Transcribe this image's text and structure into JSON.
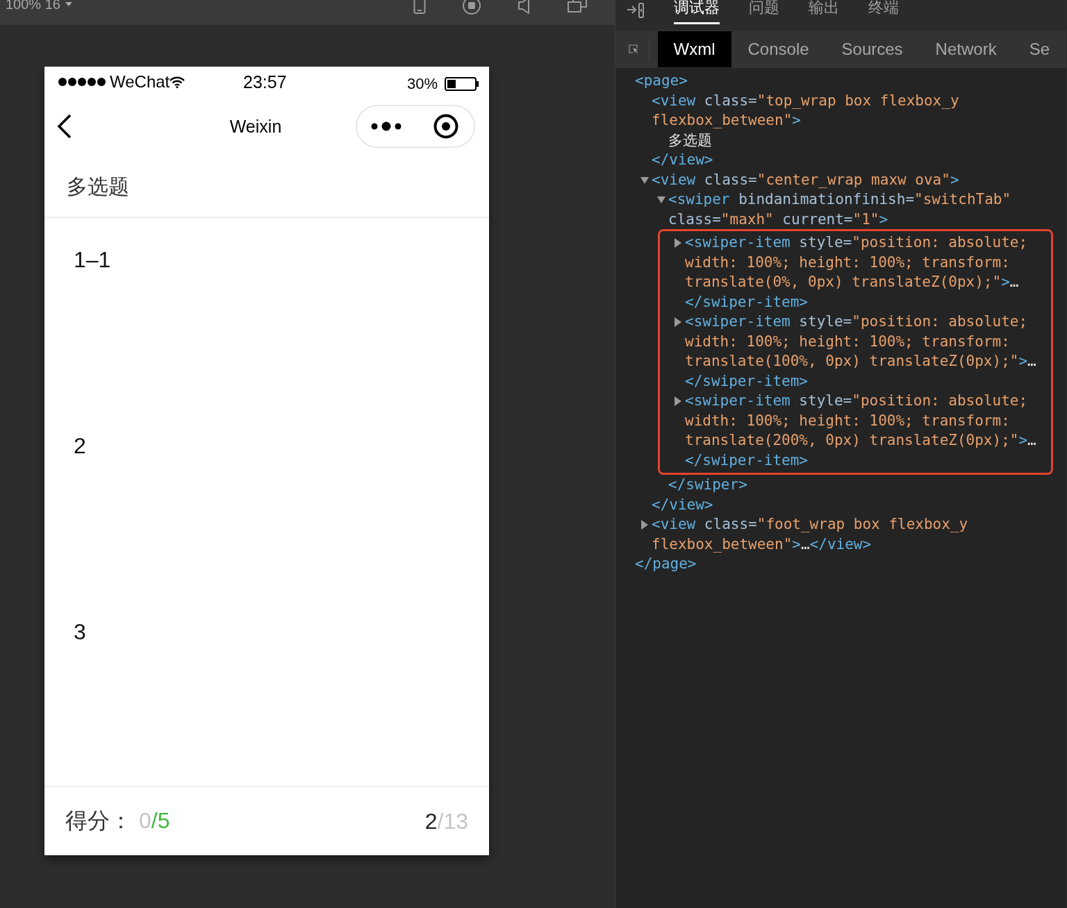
{
  "simulator": {
    "toolbar": {
      "zoom": "100% 16"
    },
    "status_bar": {
      "carrier": "WeChat",
      "time": "23:57",
      "battery": "30%"
    },
    "nav": {
      "title": "Weixin"
    },
    "header": {
      "title": "多选题"
    },
    "items": [
      {
        "label": "1–1"
      },
      {
        "label": "2"
      },
      {
        "label": "3"
      }
    ],
    "footer": {
      "score_label": "得分：",
      "score_earned": "0",
      "score_total": "/5",
      "progress_current": "2",
      "progress_rest": "/13"
    }
  },
  "devtools": {
    "top_tabs": [
      {
        "label": "调试器",
        "selected": true
      },
      {
        "label": "问题",
        "selected": false
      },
      {
        "label": "输出",
        "selected": false
      },
      {
        "label": "终端",
        "selected": false
      }
    ],
    "panel_tabs": [
      {
        "label": "Wxml",
        "selected": true
      },
      {
        "label": "Console",
        "selected": false
      },
      {
        "label": "Sources",
        "selected": false
      },
      {
        "label": "Network",
        "selected": false
      },
      {
        "label": "Se",
        "selected": false
      }
    ],
    "wxml_tree": [
      {
        "kind": "element",
        "open": [
          {
            "kind": "tag",
            "text": "<page>"
          }
        ],
        "close": [
          {
            "kind": "tag",
            "text": "</page>"
          }
        ],
        "children": [
          {
            "kind": "element",
            "open": [
              {
                "kind": "tag",
                "text": "<view"
              },
              {
                "kind": "attr",
                "text": " class="
              },
              {
                "kind": "value",
                "text": "\"top_wrap box flexbox_y flexbox_between\""
              },
              {
                "kind": "tag",
                "text": ">"
              }
            ],
            "close": [
              {
                "kind": "tag",
                "text": "</view>"
              }
            ],
            "children": [
              {
                "kind": "text",
                "open": [
                  {
                    "kind": "text",
                    "text": "多选题"
                  }
                ]
              }
            ]
          },
          {
            "kind": "toggle",
            "expanded": true,
            "open": [
              {
                "kind": "tag",
                "text": "<view"
              },
              {
                "kind": "attr",
                "text": " class="
              },
              {
                "kind": "value",
                "text": "\"center_wrap maxw ova\""
              },
              {
                "kind": "tag",
                "text": ">"
              }
            ],
            "close": [
              {
                "kind": "tag",
                "text": "</view>"
              }
            ],
            "children": [
              {
                "kind": "toggle",
                "expanded": true,
                "open": [
                  {
                    "kind": "tag",
                    "text": "<swiper"
                  },
                  {
                    "kind": "attr",
                    "text": " bindanimationfinish="
                  },
                  {
                    "kind": "value",
                    "text": "\"switchTab\""
                  },
                  {
                    "kind": "attr",
                    "text": " class="
                  },
                  {
                    "kind": "value",
                    "text": "\"maxh\""
                  },
                  {
                    "kind": "attr",
                    "text": " current="
                  },
                  {
                    "kind": "value",
                    "text": "\"1\""
                  },
                  {
                    "kind": "tag",
                    "text": ">"
                  }
                ],
                "close": [
                  {
                    "kind": "tag",
                    "text": "</swiper>"
                  }
                ],
                "children": [
                  {
                    "kind": "toggle",
                    "expanded": false,
                    "highlighted": true,
                    "open": [
                      {
                        "kind": "tag",
                        "text": "<swiper-item"
                      },
                      {
                        "kind": "attr",
                        "text": " style="
                      },
                      {
                        "kind": "value",
                        "text": "\"position: absolute; width: 100%; height: 100%; transform: translate(0%, 0px) translateZ(0px);\""
                      },
                      {
                        "kind": "tag",
                        "text": ">"
                      },
                      {
                        "kind": "text",
                        "text": "…"
                      }
                    ],
                    "close": [
                      {
                        "kind": "tag",
                        "text": "</swiper-item>"
                      }
                    ]
                  },
                  {
                    "kind": "toggle",
                    "expanded": false,
                    "highlighted": true,
                    "open": [
                      {
                        "kind": "tag",
                        "text": "<swiper-item"
                      },
                      {
                        "kind": "attr",
                        "text": " style="
                      },
                      {
                        "kind": "value",
                        "text": "\"position: absolute; width: 100%; height: 100%; transform: translate(100%, 0px) translateZ(0px);\""
                      },
                      {
                        "kind": "tag",
                        "text": ">"
                      },
                      {
                        "kind": "text",
                        "text": "…"
                      }
                    ],
                    "close": [
                      {
                        "kind": "tag",
                        "text": "</swiper-item>"
                      }
                    ]
                  },
                  {
                    "kind": "toggle",
                    "expanded": false,
                    "highlighted": true,
                    "open": [
                      {
                        "kind": "tag",
                        "text": "<swiper-item"
                      },
                      {
                        "kind": "attr",
                        "text": " style="
                      },
                      {
                        "kind": "value",
                        "text": "\"position: absolute; width: 100%; height: 100%; transform: translate(200%, 0px) translateZ(0px);\""
                      },
                      {
                        "kind": "tag",
                        "text": ">"
                      },
                      {
                        "kind": "text",
                        "text": "…"
                      }
                    ],
                    "close": [
                      {
                        "kind": "tag",
                        "text": "</swiper-item>"
                      }
                    ]
                  }
                ]
              }
            ]
          },
          {
            "kind": "toggle",
            "expanded": false,
            "open": [
              {
                "kind": "tag",
                "text": "<view"
              },
              {
                "kind": "attr",
                "text": " class="
              },
              {
                "kind": "value",
                "text": "\"foot_wrap box flexbox_y flexbox_between\""
              },
              {
                "kind": "tag",
                "text": ">"
              },
              {
                "kind": "text",
                "text": "…"
              }
            ],
            "close": [
              {
                "kind": "tag",
                "text": "</view>"
              }
            ]
          }
        ]
      }
    ]
  }
}
